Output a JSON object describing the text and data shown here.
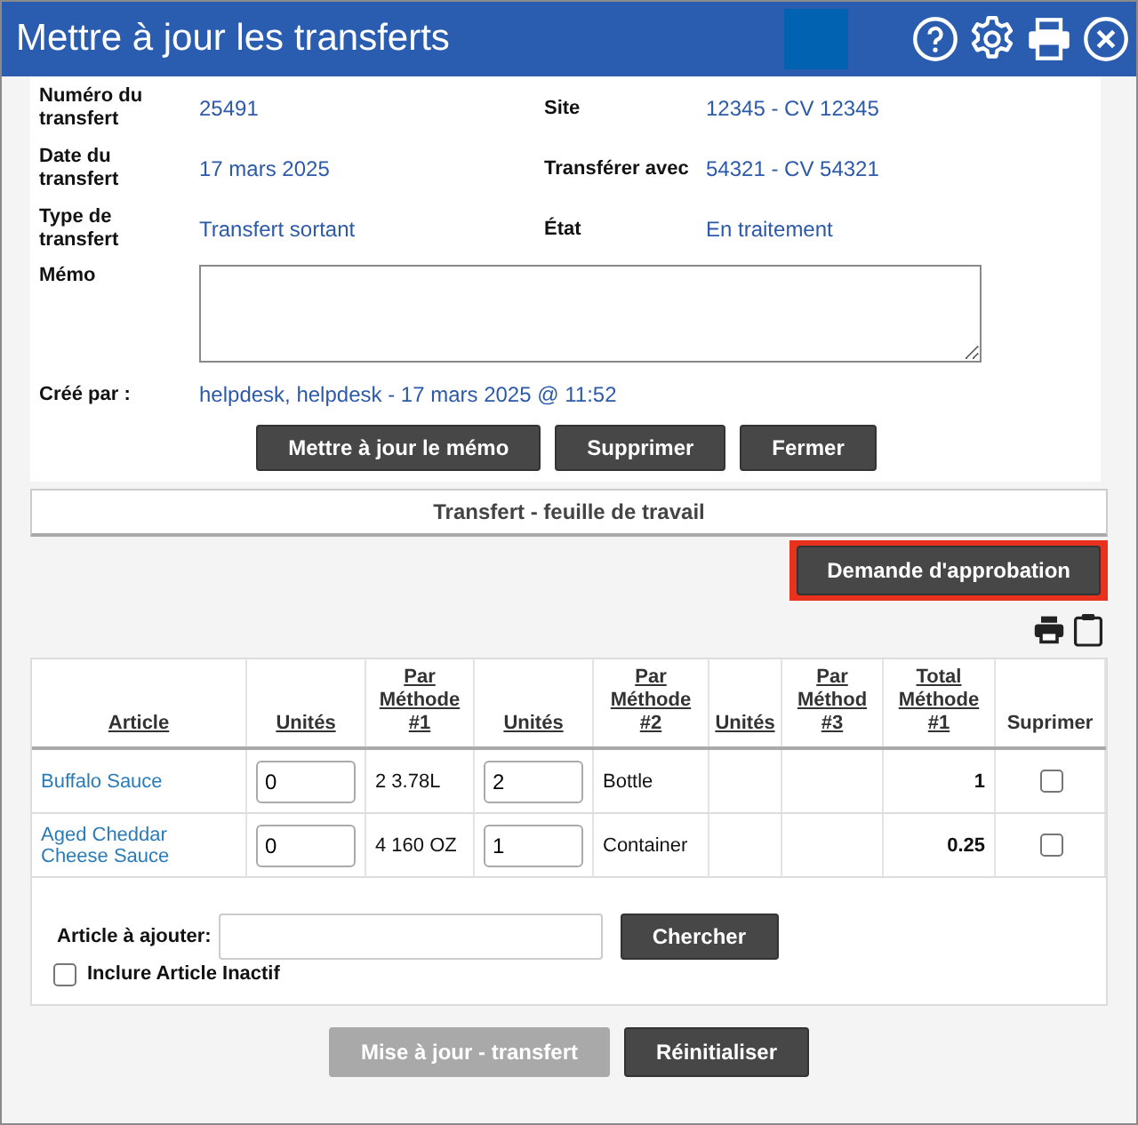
{
  "window": {
    "title": "Mettre à jour les transferts"
  },
  "details": [
    {
      "label": "Numéro du transfert",
      "value": "25491"
    },
    {
      "label": "Site",
      "value": "12345 - CV 12345"
    },
    {
      "label": "Date du transfert",
      "value": "17 mars 2025"
    },
    {
      "label": "Transférer avec",
      "value": "54321 - CV 54321"
    },
    {
      "label": "Type de transfert",
      "value": "Transfert sortant"
    },
    {
      "label": "État",
      "value": "En traitement"
    }
  ],
  "memo": {
    "label": "Mémo"
  },
  "created_by": {
    "label": "Créé par :",
    "value": "helpdesk, helpdesk - 17 mars 2025 @ 11:52"
  },
  "memo_buttons": [
    "Mettre à jour le mémo",
    "Supprimer",
    "Fermer"
  ],
  "worksheet": {
    "title": "Transfert - feuille de travail",
    "approval_button": "Demande d'approbation"
  },
  "table": {
    "columns": [
      {
        "label": "Article",
        "underlined": true
      },
      {
        "label": "Unités",
        "underlined": true
      },
      {
        "label": "Par Méthode #1",
        "underlined": true
      },
      {
        "label": "Unités",
        "underlined": true
      },
      {
        "label": "Par Méthode #2",
        "underlined": true
      },
      {
        "label": "Unités",
        "underlined": true
      },
      {
        "label": "Par Méthod #3",
        "underlined": true
      },
      {
        "label": "Total Méthode #1",
        "underlined": true
      },
      {
        "label": "Suprimer",
        "underlined": false
      }
    ],
    "rows": [
      {
        "article": "Buffalo Sauce",
        "units_1": "0",
        "per_method_1": "2 3.78L",
        "units_2": "2",
        "per_method_2": "Bottle",
        "total": "1",
        "delete": false
      },
      {
        "article": "Aged Cheddar Cheese Sauce",
        "units_1": "0",
        "per_method_1": "4 160 OZ",
        "units_2": "1",
        "per_method_2": "Container",
        "total": "0.25",
        "delete": false
      }
    ]
  },
  "add_item": {
    "label": "Article à ajouter:",
    "search_button": "Chercher",
    "include_inactive": {
      "label": "Inclure Article Inactif",
      "checked": false
    }
  },
  "footer_buttons": [
    {
      "label": "Mise à jour - transfert",
      "disabled": true
    },
    {
      "label": "Réinitialiser",
      "disabled": false
    }
  ]
}
